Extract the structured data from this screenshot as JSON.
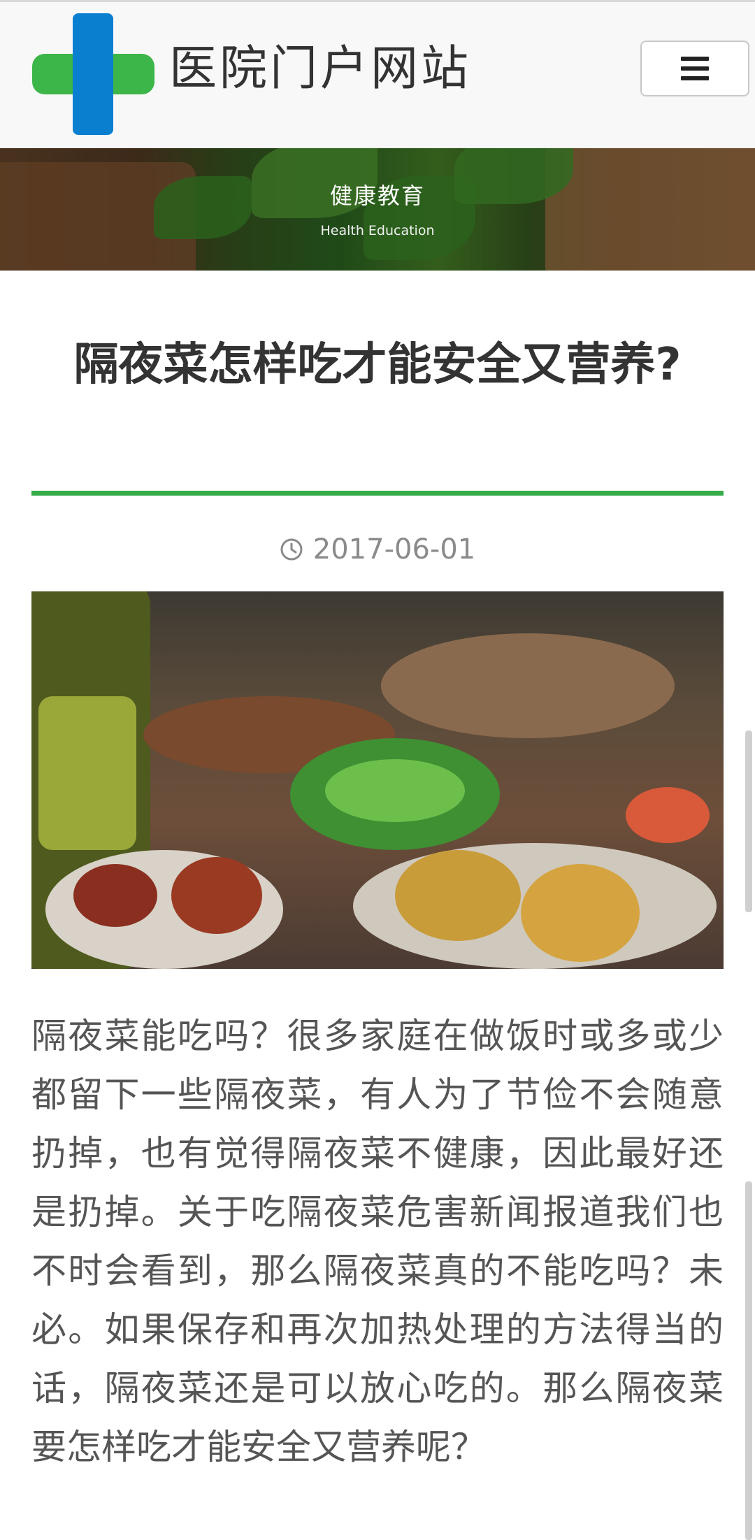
{
  "header": {
    "site_name": "医院门户网站",
    "logo_icon": "medical-cross-icon",
    "menu_icon": "hamburger-menu-icon",
    "colors": {
      "cross_green": "#3cb648",
      "cross_blue": "#0a7fd0"
    }
  },
  "banner": {
    "title": "健康教育",
    "subtitle": "Health Education"
  },
  "article": {
    "title": "隔夜菜怎样吃才能安全又营养?",
    "date": "2017-06-01",
    "date_icon": "clock-icon",
    "accent_color": "#35ac48",
    "body": "  隔夜菜能吃吗？很多家庭在做饭时或多或少都留下一些隔夜菜，有人为了节俭不会随意扔掉，也有觉得隔夜菜不健康，因此最好还是扔掉。关于吃隔夜菜危害新闻报道我们也不时会看到，那么隔夜菜真的不能吃吗？未必。如果保存和再次加热处理的方法得当的话，隔夜菜还是可以放心吃的。那么隔夜菜要怎样吃才能安全又营养呢？"
  }
}
